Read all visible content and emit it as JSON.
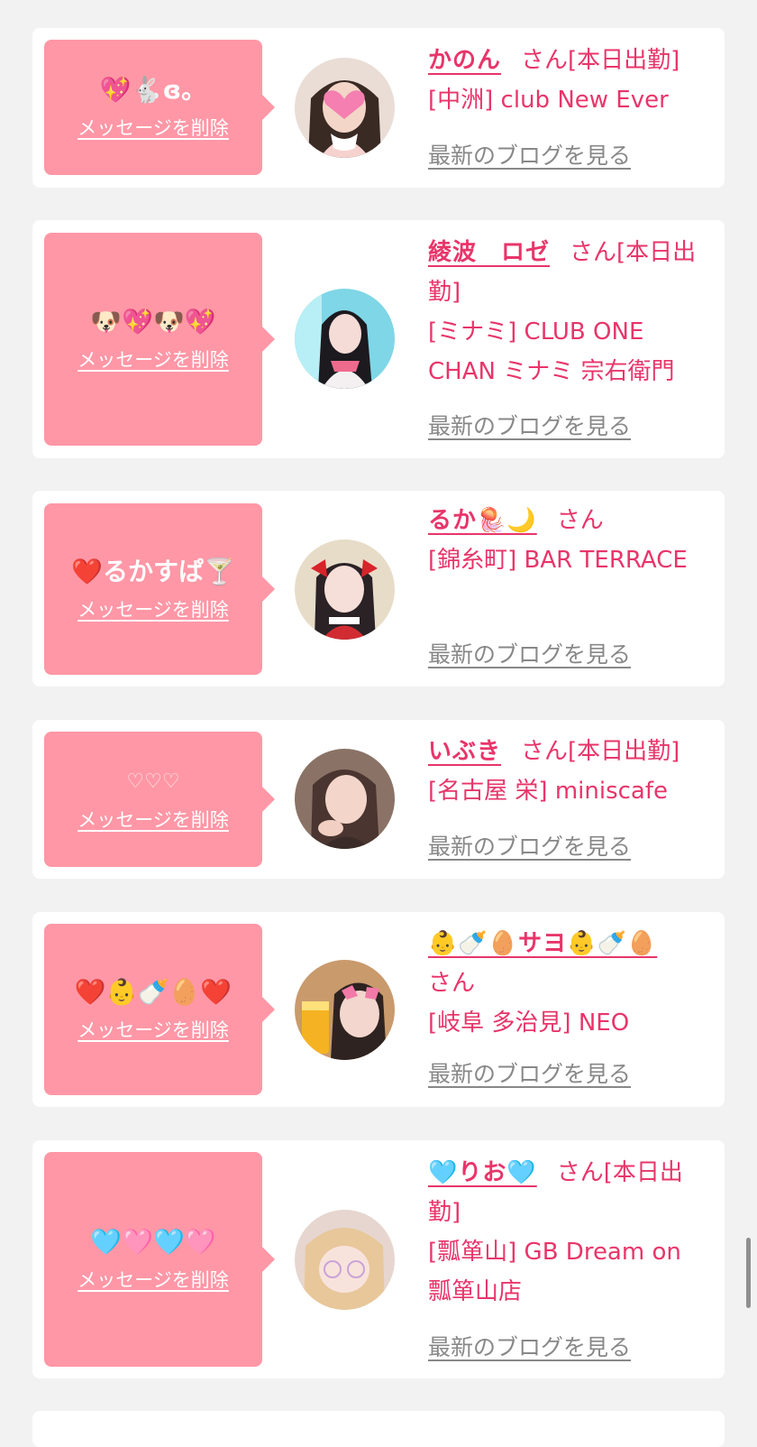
{
  "entries": [
    {
      "comment": "💖🐇ɞ。",
      "delete_label": "メッセージを削除",
      "name": "かのん",
      "honorific": "さん",
      "status": "[本日出勤]",
      "shop": "[中洲] club New Ever",
      "blog_label": "最新のブログを見る"
    },
    {
      "comment": "🐶💖🐶💖",
      "delete_label": "メッセージを削除",
      "name": "綾波　ロゼ",
      "honorific": "さん",
      "status": "[本日出勤]",
      "shop": "[ミナミ] CLUB ONE CHAN ミナミ 宗右衛門",
      "blog_label": "最新のブログを見る"
    },
    {
      "comment": "❤️るかすぱ🍸",
      "delete_label": "メッセージを削除",
      "name": "るか🪼🌙",
      "honorific": "さん",
      "status": "",
      "shop": "[錦糸町] BAR TERRACE",
      "blog_label": "最新のブログを見る"
    },
    {
      "comment": "♡♡♡",
      "delete_label": "メッセージを削除",
      "name": "いぶき",
      "honorific": "さん",
      "status": "[本日出勤]",
      "shop": "[名古屋 栄] miniscafe",
      "blog_label": "最新のブログを見る"
    },
    {
      "comment": "❤️👶🍼🥚❤️",
      "delete_label": "メッセージを削除",
      "name": "👶🍼🥚サヨ👶🍼🥚",
      "honorific": "さん",
      "status": "",
      "shop": "[岐阜 多治見] NEO",
      "blog_label": "最新のブログを見る"
    },
    {
      "comment": "🩵🩷🩵🩷",
      "delete_label": "メッセージを削除",
      "name": "🩵りお🩵",
      "honorific": "さん",
      "status": "[本日出勤]",
      "shop": "[瓢箪山] GB Dream on　瓢箪山店",
      "blog_label": "最新のブログを見る"
    }
  ],
  "colors": {
    "page_bg": "#f2f2f2",
    "card_bg": "#ffffff",
    "bubble_bg": "#ff97a6",
    "accent_text": "#e8356a",
    "link_gray": "#888888"
  }
}
